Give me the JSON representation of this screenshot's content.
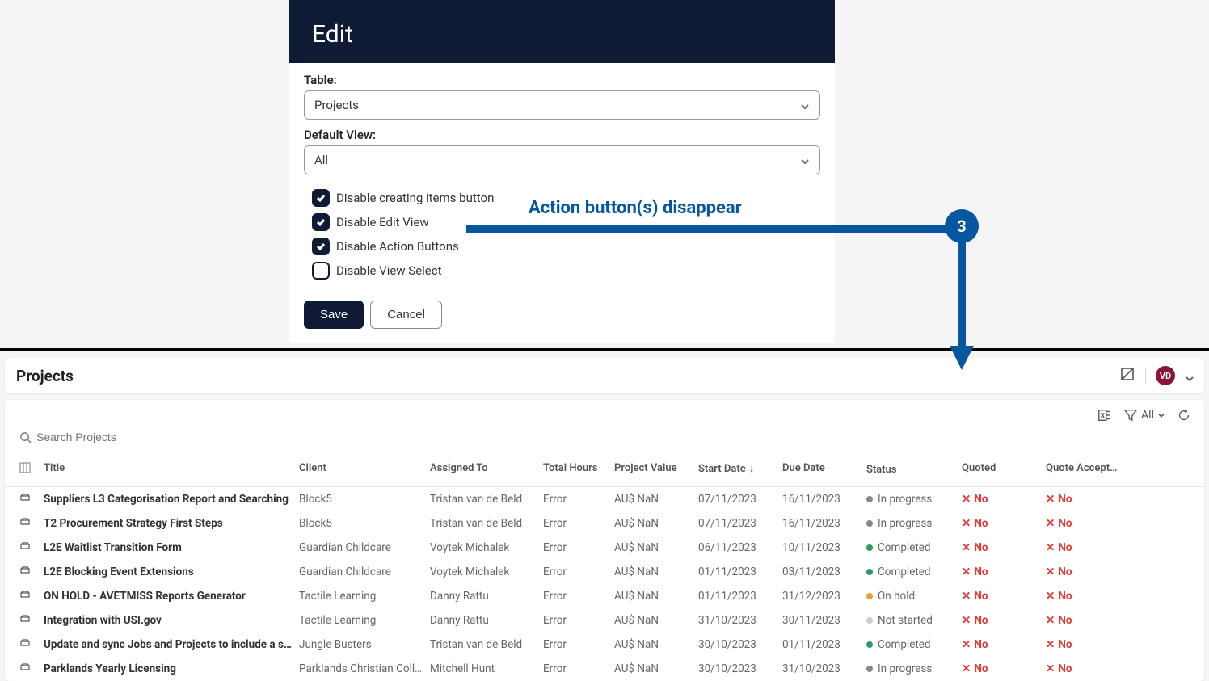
{
  "modal": {
    "title": "Edit",
    "table_label": "Table:",
    "table_value": "Projects",
    "view_label": "Default View:",
    "view_value": "All",
    "checkboxes": [
      {
        "label": "Disable creating items button",
        "checked": true
      },
      {
        "label": "Disable Edit View",
        "checked": true
      },
      {
        "label": "Disable Action Buttons",
        "checked": true
      },
      {
        "label": "Disable View Select",
        "checked": false
      }
    ],
    "save_label": "Save",
    "cancel_label": "Cancel"
  },
  "callout": {
    "text": "Action button(s) disappear",
    "badge": "3"
  },
  "page": {
    "title": "Projects",
    "avatar": "VD",
    "filter_label": "All",
    "search_placeholder": "Search Projects"
  },
  "table": {
    "headers": {
      "title": "Title",
      "client": "Client",
      "assigned": "Assigned To",
      "hours": "Total Hours",
      "value": "Project Value",
      "start": "Start Date",
      "due": "Due Date",
      "status": "Status",
      "quoted": "Quoted",
      "accept": "Quote Accept…"
    },
    "rows": [
      {
        "title": "Suppliers L3 Categorisation Report and Searching",
        "client": "Block5",
        "assigned": "Tristan van de Beld",
        "hours": "Error",
        "value": "AU$ NaN",
        "start": "07/11/2023",
        "due": "16/11/2023",
        "status": "In progress",
        "dot": "grey",
        "quoted": "No",
        "accept": "No"
      },
      {
        "title": "T2 Procurement Strategy First Steps",
        "client": "Block5",
        "assigned": "Tristan van de Beld",
        "hours": "Error",
        "value": "AU$ NaN",
        "start": "07/11/2023",
        "due": "16/11/2023",
        "status": "In progress",
        "dot": "grey",
        "quoted": "No",
        "accept": "No"
      },
      {
        "title": "L2E Waitlist Transition Form",
        "client": "Guardian Childcare",
        "assigned": "Voytek Michalek",
        "hours": "Error",
        "value": "AU$ NaN",
        "start": "06/11/2023",
        "due": "10/11/2023",
        "status": "Completed",
        "dot": "green",
        "quoted": "No",
        "accept": "No"
      },
      {
        "title": "L2E Blocking Event Extensions",
        "client": "Guardian Childcare",
        "assigned": "Voytek Michalek",
        "hours": "Error",
        "value": "AU$ NaN",
        "start": "01/11/2023",
        "due": "03/11/2023",
        "status": "Completed",
        "dot": "green",
        "quoted": "No",
        "accept": "No"
      },
      {
        "title": "ON HOLD - AVETMISS Reports Generator",
        "client": "Tactile Learning",
        "assigned": "Danny Rattu",
        "hours": "Error",
        "value": "AU$ NaN",
        "start": "01/11/2023",
        "due": "31/12/2023",
        "status": "On hold",
        "dot": "orange",
        "quoted": "No",
        "accept": "No"
      },
      {
        "title": "Integration with USI.gov",
        "client": "Tactile Learning",
        "assigned": "Danny Rattu",
        "hours": "Error",
        "value": "AU$ NaN",
        "start": "31/10/2023",
        "due": "30/11/2023",
        "status": "Not started",
        "dot": "lgrey",
        "quoted": "No",
        "accept": "No"
      },
      {
        "title": "Update and sync Jobs and Projects to include a sin…",
        "client": "Jungle Busters",
        "assigned": "Tristan van de Beld",
        "hours": "Error",
        "value": "AU$ NaN",
        "start": "30/10/2023",
        "due": "01/11/2023",
        "status": "Completed",
        "dot": "green",
        "quoted": "No",
        "accept": "No"
      },
      {
        "title": "Parklands Yearly Licensing",
        "client": "Parklands Christian College",
        "assigned": "Mitchell Hunt",
        "hours": "Error",
        "value": "AU$ NaN",
        "start": "30/10/2023",
        "due": "31/10/2023",
        "status": "In progress",
        "dot": "grey",
        "quoted": "No",
        "accept": "No"
      }
    ]
  }
}
